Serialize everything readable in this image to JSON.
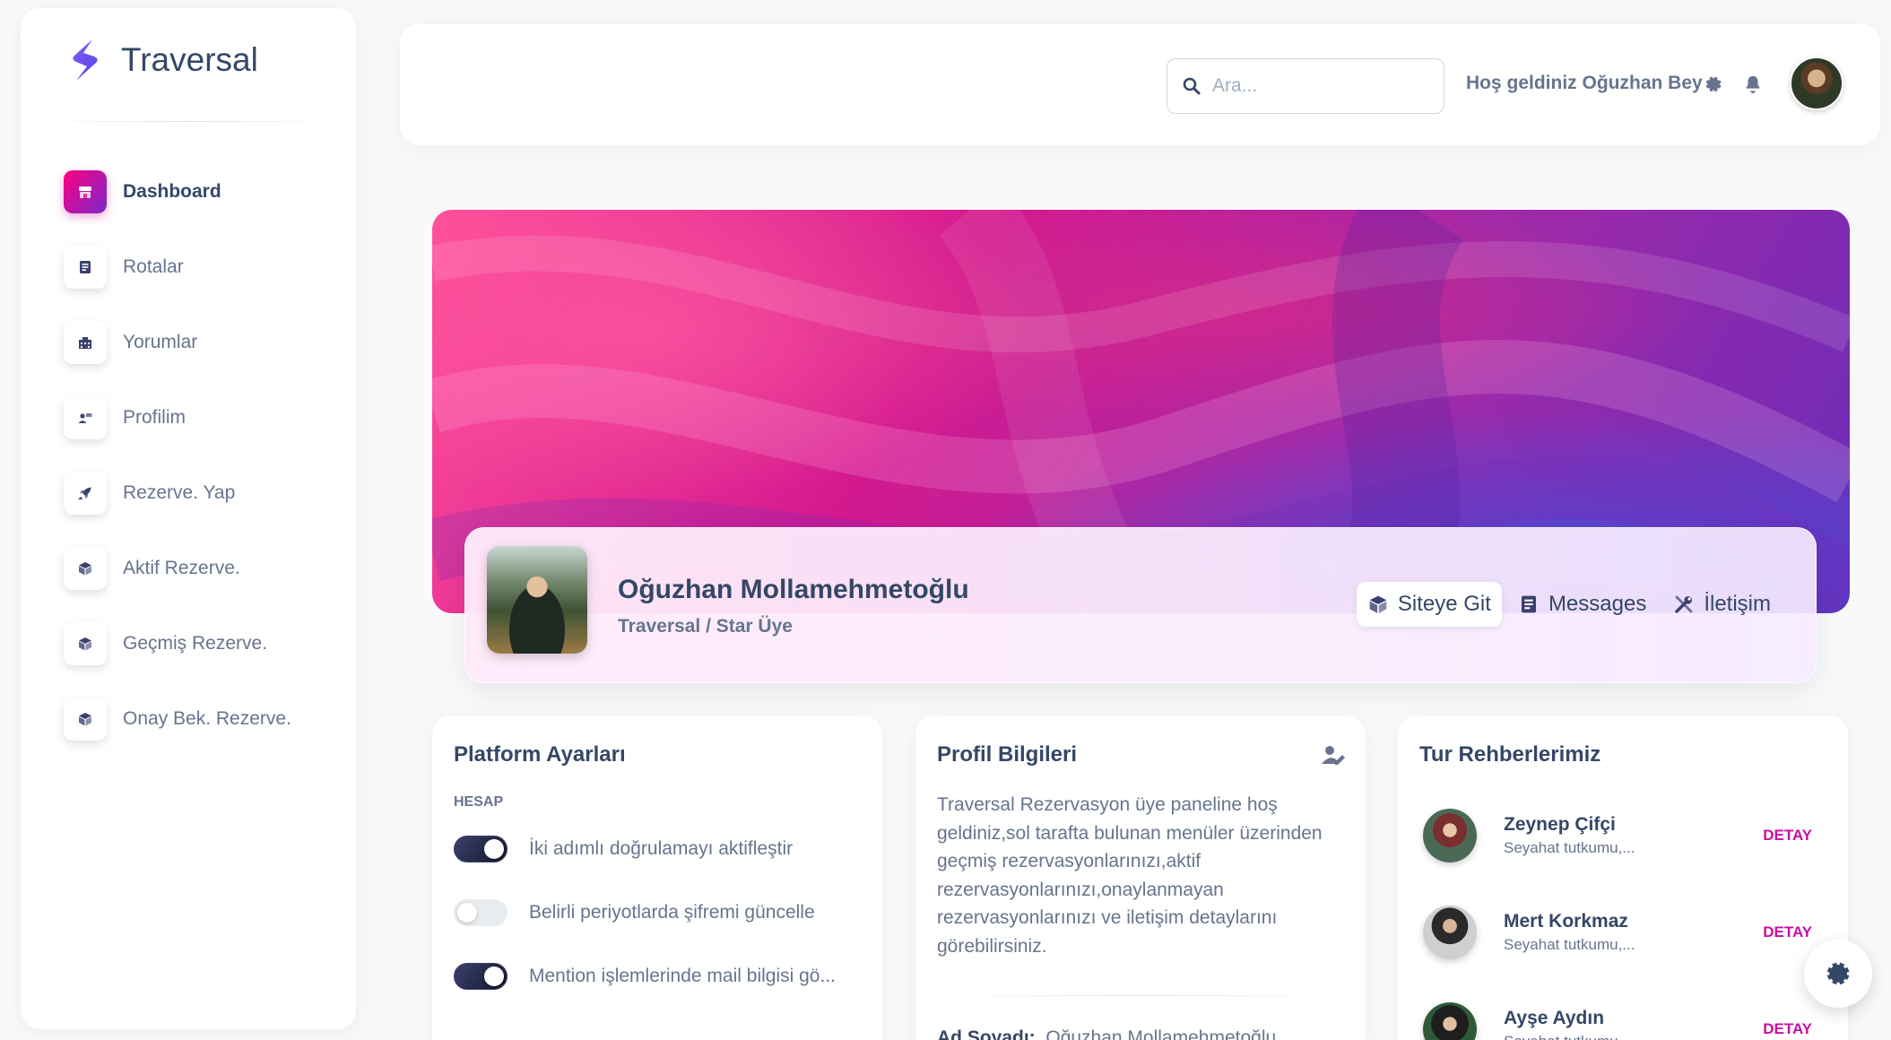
{
  "brand": {
    "name": "Traversal"
  },
  "sidebar": {
    "items": [
      {
        "label": "Dashboard",
        "icon": "shop-icon",
        "active": true
      },
      {
        "label": "Rotalar",
        "icon": "document-icon"
      },
      {
        "label": "Yorumlar",
        "icon": "building-icon"
      },
      {
        "label": "Profilim",
        "icon": "user-card-icon"
      },
      {
        "label": "Rezerve. Yap",
        "icon": "rocket-icon"
      },
      {
        "label": "Aktif Rezerve.",
        "icon": "box-icon"
      },
      {
        "label": "Geçmiş Rezerve.",
        "icon": "box-icon"
      },
      {
        "label": "Onay Bek. Rezerve.",
        "icon": "box-icon"
      }
    ]
  },
  "topbar": {
    "search_placeholder": "Ara...",
    "welcome": "Hoş geldiniz Oğuzhan Bey"
  },
  "profile": {
    "name": "Oğuzhan Mollamehmetoğlu",
    "subtitle": "Traversal / Star Üye",
    "tabs": [
      {
        "label": "Siteye Git",
        "icon": "cube-icon",
        "active": true
      },
      {
        "label": "Messages",
        "icon": "document-icon"
      },
      {
        "label": "İletişim",
        "icon": "tools-icon"
      }
    ]
  },
  "platform_settings": {
    "title": "Platform Ayarları",
    "section": "HESAP",
    "switches": [
      {
        "label": "İki adımlı doğrulamayı aktifleştir",
        "on": true
      },
      {
        "label": "Belirli periyotlarda şifremi güncelle",
        "on": false
      },
      {
        "label": "Mention işlemlerinde mail bilgisi gö...",
        "on": true
      }
    ]
  },
  "profile_info": {
    "title": "Profil Bilgileri",
    "text": "Traversal Rezervasyon üye paneline hoş geldiniz,sol tarafta bulunan menüler üzerinden geçmiş rezervasyonlarınızı,aktif rezervasyonlarınızı,onaylanmayan rezervasyonlarınızı ve iletişim detaylarını görebilirsiniz.",
    "name_label": "Ad Soyadı:",
    "name_value": "Oğuzhan Mollamehmetoğlu"
  },
  "guides": {
    "title": "Tur Rehberlerimiz",
    "items": [
      {
        "name": "Zeynep Çifçi",
        "desc": "Seyahat tutkumu,...",
        "action": "DETAY"
      },
      {
        "name": "Mert Korkmaz",
        "desc": "Seyahat tutkumu,...",
        "action": "DETAY"
      },
      {
        "name": "Ayşe Aydın",
        "desc": "Seyahat tutkumu,...",
        "action": "DETAY"
      }
    ]
  },
  "colors": {
    "accent": "#cb0c9f",
    "text": "#344767",
    "muted": "#67748e"
  }
}
